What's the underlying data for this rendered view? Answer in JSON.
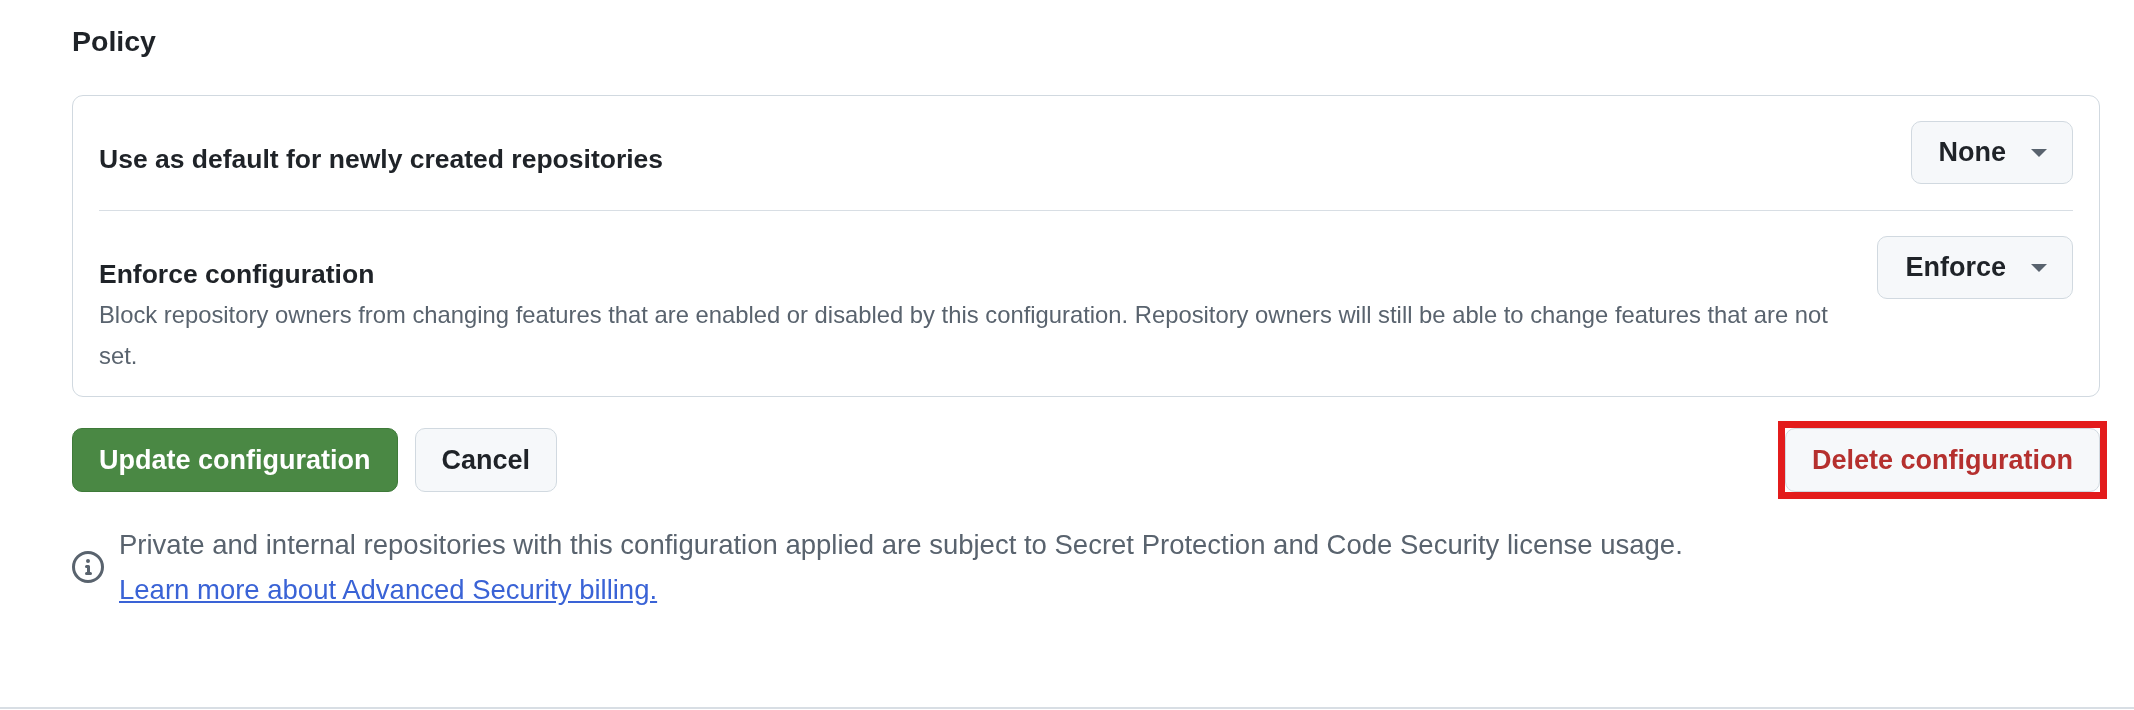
{
  "section": {
    "title": "Policy"
  },
  "settings": [
    {
      "label": "Use as default for newly created repositories",
      "dropdown": {
        "value": "None"
      }
    },
    {
      "label": "Enforce configuration",
      "description": "Block repository owners from changing features that are enabled or disabled by this configuration. Repository owners will still be able to change features that are not set.",
      "dropdown": {
        "value": "Enforce"
      }
    }
  ],
  "actions": [
    {
      "label": "Update configuration",
      "kind": "primary",
      "highlighted": false
    },
    {
      "label": "Cancel",
      "kind": "secondary",
      "highlighted": false
    },
    {
      "label": "Delete configuration",
      "kind": "danger",
      "highlighted": true
    }
  ],
  "notice": {
    "text": "Private and internal repositories with this configuration applied are subject to Secret Protection and Code Security license usage.",
    "link": "Learn more about Advanced Security billing."
  }
}
